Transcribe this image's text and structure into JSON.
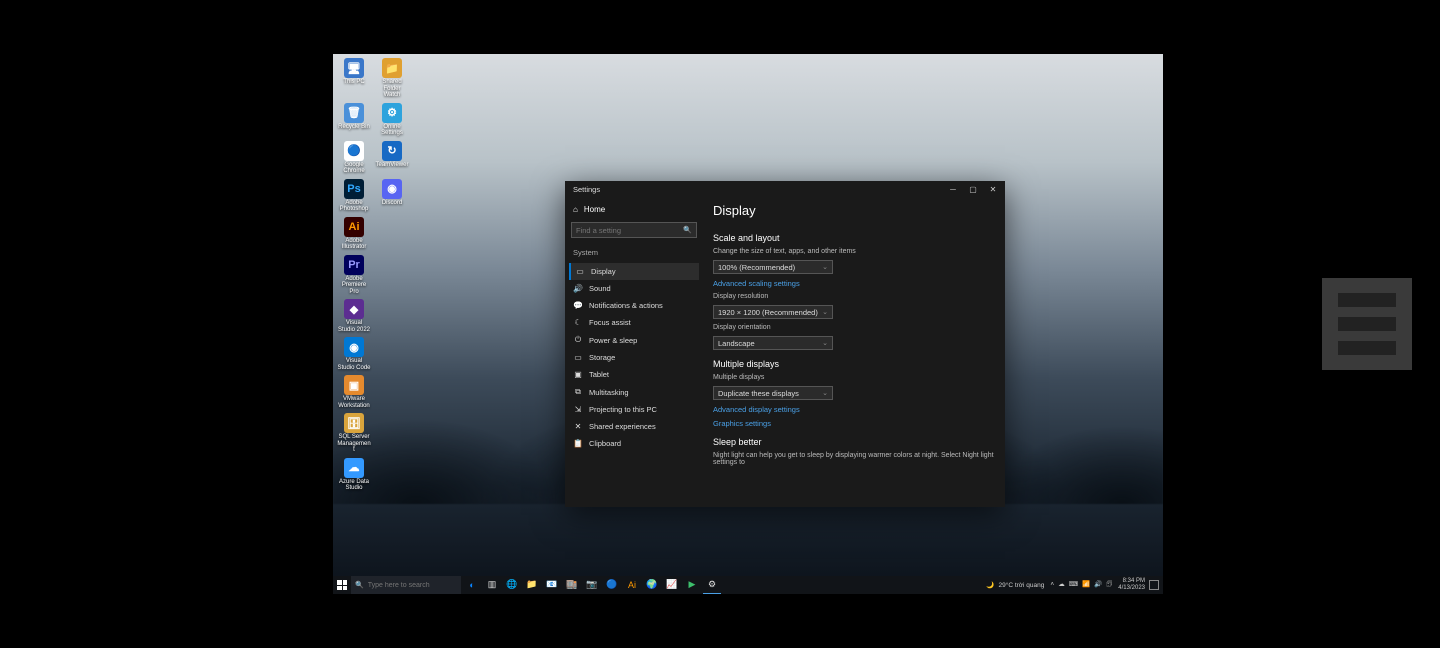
{
  "desktop": {
    "icons": [
      [
        {
          "label": "This PC",
          "bg": "#3a77c9",
          "glyph": "🖥"
        },
        {
          "label": "Shared Folder Watch",
          "bg": "#e0a030",
          "glyph": "📁"
        }
      ],
      [
        {
          "label": "Recycle Bin",
          "bg": "#4a90d9",
          "glyph": "🗑"
        },
        {
          "label": "Online Settings",
          "bg": "#2ea3dd",
          "glyph": "⚙"
        }
      ],
      [
        {
          "label": "Google Chrome",
          "bg": "#ffffff",
          "glyph": "🔵"
        },
        {
          "label": "TeamViewer",
          "bg": "#1769c4",
          "glyph": "↻"
        }
      ],
      [
        {
          "label": "Adobe Photoshop",
          "bg": "#001e36",
          "glyph": "Ps",
          "fg": "#31a8ff"
        },
        {
          "label": "Discord",
          "bg": "#5865f2",
          "glyph": "◉"
        }
      ],
      [
        {
          "label": "Adobe Illustrator",
          "bg": "#330000",
          "glyph": "Ai",
          "fg": "#ff9a00"
        }
      ],
      [
        {
          "label": "Adobe Premiere Pro",
          "bg": "#00005b",
          "glyph": "Pr",
          "fg": "#9999ff"
        }
      ],
      [
        {
          "label": "Visual Studio 2022",
          "bg": "#5c2d91",
          "glyph": "◆"
        }
      ],
      [
        {
          "label": "Visual Studio Code",
          "bg": "#0078d4",
          "glyph": "◉"
        }
      ],
      [
        {
          "label": "VMware Workstation",
          "bg": "#e58a2e",
          "glyph": "▣"
        }
      ],
      [
        {
          "label": "SQL Server Management",
          "bg": "#d9a43c",
          "glyph": "🗄"
        }
      ],
      [
        {
          "label": "Azure Data Studio",
          "bg": "#3399ff",
          "glyph": "☁"
        }
      ]
    ]
  },
  "settings": {
    "title": "Settings",
    "home": "Home",
    "search_placeholder": "Find a setting",
    "section": "System",
    "sidebar": [
      {
        "icon": "▭",
        "label": "Display",
        "active": true
      },
      {
        "icon": "🔊",
        "label": "Sound"
      },
      {
        "icon": "💬",
        "label": "Notifications & actions"
      },
      {
        "icon": "☾",
        "label": "Focus assist"
      },
      {
        "icon": "⏻",
        "label": "Power & sleep"
      },
      {
        "icon": "▭",
        "label": "Storage"
      },
      {
        "icon": "▣",
        "label": "Tablet"
      },
      {
        "icon": "⧉",
        "label": "Multitasking"
      },
      {
        "icon": "⇲",
        "label": "Projecting to this PC"
      },
      {
        "icon": "✕",
        "label": "Shared experiences"
      },
      {
        "icon": "📋",
        "label": "Clipboard"
      }
    ],
    "content": {
      "h1": "Display",
      "scale_h": "Scale and layout",
      "scale_hint": "Change the size of text, apps, and other items",
      "scale_value": "100% (Recommended)",
      "adv_scale_link": "Advanced scaling settings",
      "res_label": "Display resolution",
      "res_value": "1920 × 1200 (Recommended)",
      "orient_label": "Display orientation",
      "orient_value": "Landscape",
      "multi_h": "Multiple displays",
      "multi_label": "Multiple displays",
      "multi_value": "Duplicate these displays",
      "adv_disp_link": "Advanced display settings",
      "graphics_link": "Graphics settings",
      "sleep_h": "Sleep better",
      "sleep_hint": "Night light can help you get to sleep by displaying warmer colors at night. Select Night light settings to"
    }
  },
  "taskbar": {
    "search_placeholder": "Type here to search",
    "apps": [
      {
        "glyph": "◐",
        "color": "#0a84ff",
        "name": "cortana"
      },
      {
        "glyph": "▥",
        "color": "#e0e0e0",
        "name": "task-view"
      },
      {
        "glyph": "🌐",
        "color": "#1f8ae0",
        "name": "edge"
      },
      {
        "glyph": "📁",
        "color": "#f7c96b",
        "name": "file-explorer"
      },
      {
        "glyph": "📧",
        "color": "#2e86de",
        "name": "mail"
      },
      {
        "glyph": "🏬",
        "color": "#2ea3dd",
        "name": "store"
      },
      {
        "glyph": "📷",
        "color": "#d98a2e",
        "name": "camera"
      },
      {
        "glyph": "🔵",
        "color": "#f2c33c",
        "name": "chrome"
      },
      {
        "glyph": "Ai",
        "color": "#ff9a00",
        "name": "illustrator"
      },
      {
        "glyph": "🌍",
        "color": "#2ea3dd",
        "name": "browser"
      },
      {
        "glyph": "📈",
        "color": "#3dbf6c",
        "name": "app1"
      },
      {
        "glyph": "▶",
        "color": "#3dbf6c",
        "name": "app2"
      },
      {
        "glyph": "⚙",
        "color": "#e0e0e0",
        "name": "settings",
        "active": true
      }
    ],
    "weather_icon": "🌙",
    "weather": "29°C  trời quang",
    "tray": [
      "˄",
      "☁",
      "⌨",
      "📶",
      "🔊",
      "🗊"
    ],
    "time": "8:34 PM",
    "date": "4/13/2023"
  }
}
